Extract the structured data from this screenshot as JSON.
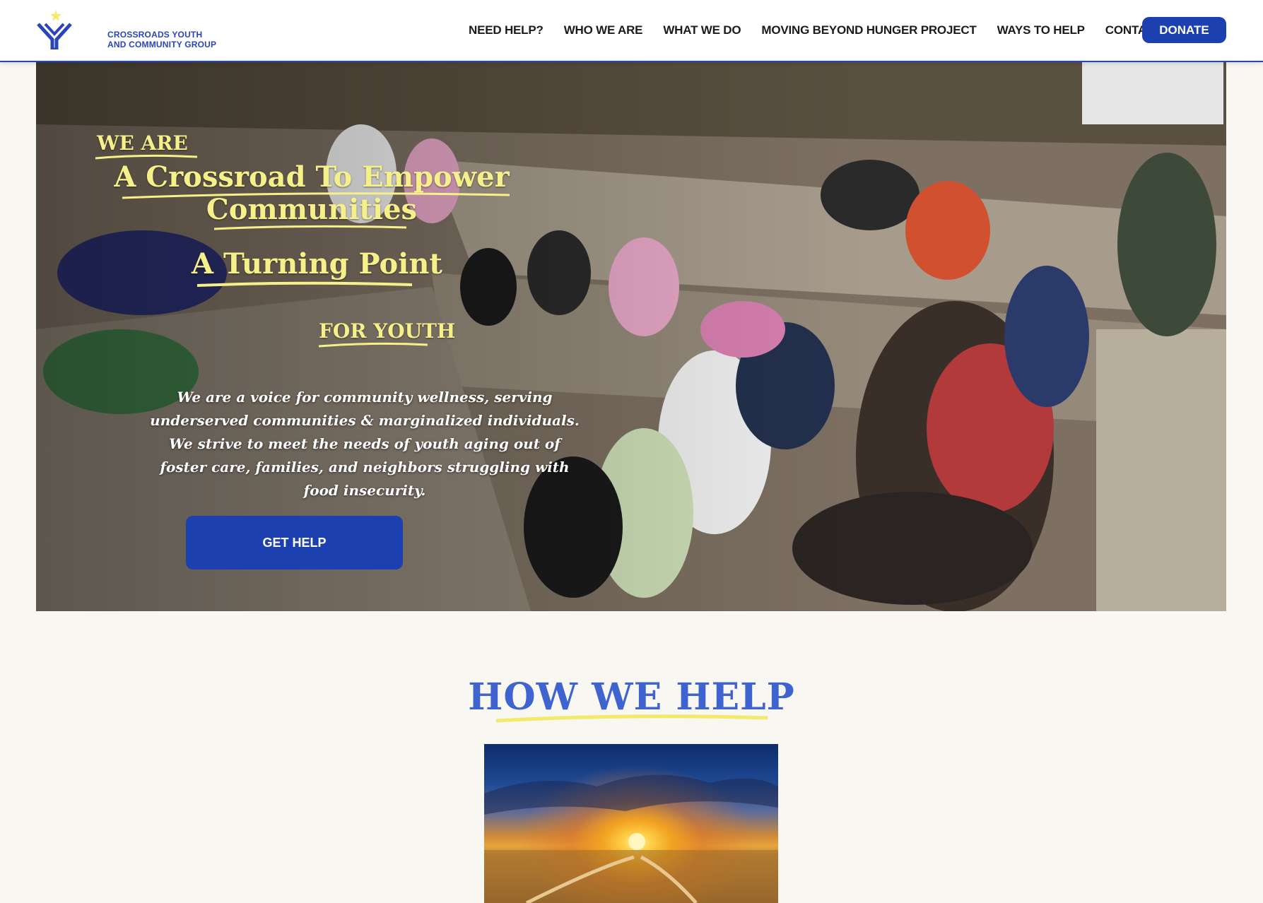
{
  "header": {
    "logo_line1": "CROSSROADS YOUTH",
    "logo_line2": "AND COMMUNITY GROUP",
    "nav": [
      {
        "label": "NEED HELP?"
      },
      {
        "label": "WHO WE ARE"
      },
      {
        "label": "WHAT WE DO"
      },
      {
        "label": "MOVING BEYOND HUNGER PROJECT"
      },
      {
        "label": "WAYS TO HELP"
      },
      {
        "label": "CONTACT"
      }
    ],
    "donate_label": "DONATE"
  },
  "hero": {
    "we_are": "WE ARE",
    "tagline1": "A Crossroad To  Empower Communities",
    "tagline2": "A Turning Point",
    "for_youth": "FOR YOUTH",
    "description": "We are a voice for community wellness, serving underserved communities & marginalized individuals.  We strive to meet the needs of youth aging out of foster care, families, and neighbors struggling with food insecurity.",
    "button_label": "GET HELP"
  },
  "how_we_help": {
    "title": "HOW WE HELP"
  },
  "colors": {
    "brand_blue": "#1d40b0",
    "heading_blue": "#3f63cf",
    "highlight_yellow": "#f6f08a",
    "page_bg": "#f8f7f1"
  }
}
